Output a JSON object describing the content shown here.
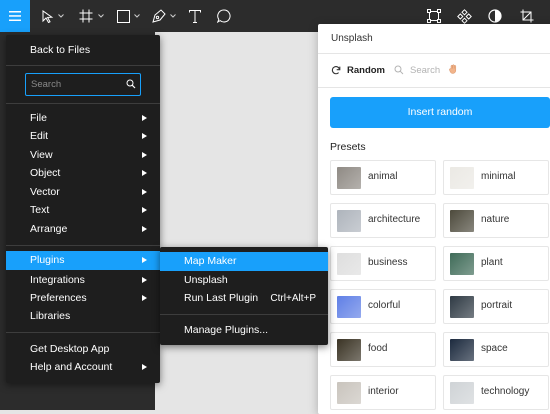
{
  "colors": {
    "accent": "#18a0fb",
    "toolbar_bg": "#2c2c2c",
    "menu_bg": "#1e1e1e"
  },
  "toolbar": {
    "icons": [
      "hamburger-menu-icon",
      "move-tool-icon",
      "frame-tool-icon",
      "shape-tool-icon",
      "pen-tool-icon",
      "text-tool-icon",
      "comment-tool-icon",
      "component-icon",
      "components-grid-icon",
      "contrast-icon",
      "crop-icon"
    ]
  },
  "menu": {
    "back": "Back to Files",
    "search_placeholder": "Search",
    "items": [
      {
        "label": "File"
      },
      {
        "label": "Edit"
      },
      {
        "label": "View"
      },
      {
        "label": "Object"
      },
      {
        "label": "Vector"
      },
      {
        "label": "Text"
      },
      {
        "label": "Arrange"
      }
    ],
    "items2": [
      {
        "label": "Plugins"
      },
      {
        "label": "Integrations"
      },
      {
        "label": "Preferences"
      },
      {
        "label": "Libraries"
      }
    ],
    "get_desktop": "Get Desktop App",
    "help": "Help and Account"
  },
  "submenu": {
    "map_maker": "Map Maker",
    "unsplash": "Unsplash",
    "run_last": "Run Last Plugin",
    "run_last_shortcut": "Ctrl+Alt+P",
    "manage": "Manage Plugins..."
  },
  "panel": {
    "title": "Unsplash",
    "tab_random": "Random",
    "tab_search": "Search",
    "insert_random": "Insert random",
    "presets_label": "Presets",
    "presets": [
      {
        "label": "animal",
        "thumb_color": "#8f8a84"
      },
      {
        "label": "minimal",
        "thumb_color": "#ebe9e4"
      },
      {
        "label": "architecture",
        "thumb_color": "#aeb4bc"
      },
      {
        "label": "nature",
        "thumb_color": "#4d4a3c"
      },
      {
        "label": "business",
        "thumb_color": "#dedede"
      },
      {
        "label": "plant",
        "thumb_color": "#3f6b58"
      },
      {
        "label": "colorful",
        "thumb_color": "#5f7fe6"
      },
      {
        "label": "portrait",
        "thumb_color": "#2f3a44"
      },
      {
        "label": "food",
        "thumb_color": "#3a3324"
      },
      {
        "label": "space",
        "thumb_color": "#1c2a3e"
      },
      {
        "label": "interior",
        "thumb_color": "#c9c4bd"
      },
      {
        "label": "technology",
        "thumb_color": "#cfd3d6"
      }
    ]
  }
}
